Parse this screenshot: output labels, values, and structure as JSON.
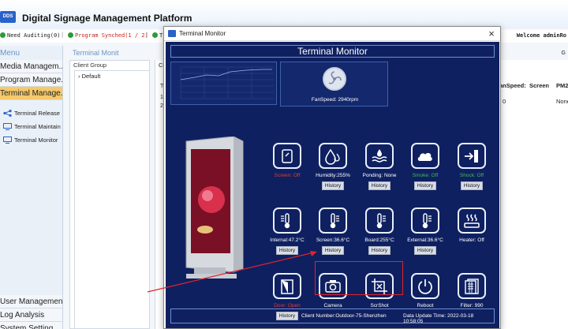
{
  "app": {
    "logo_text": "DDS",
    "title": "Digital Signage Management Platform",
    "status": [
      {
        "text": "Need Auditing(0)",
        "style": "normal"
      },
      {
        "text": "Program Synched(1 / 2)",
        "style": "red"
      },
      {
        "text": "T",
        "style": "normal"
      }
    ],
    "welcome": "Welcome adminRo"
  },
  "sidebar": {
    "menu_label": "Menu",
    "items": [
      {
        "label": "Media Managem..."
      },
      {
        "label": "Program Manage..."
      },
      {
        "label": "Terminal Manage..."
      }
    ],
    "sub_items": [
      {
        "label": "Terminal Release",
        "icon": "share-icon"
      },
      {
        "label": "Terminal Maintain",
        "icon": "monitor-icon"
      },
      {
        "label": "Terminal Monitor",
        "icon": "monitor-icon"
      }
    ],
    "bottom_items": [
      {
        "label": "User Management"
      },
      {
        "label": "Log Analysis"
      },
      {
        "label": "System Setting"
      }
    ]
  },
  "main": {
    "section_title": "Terminal Monit",
    "client_group_label": "Client Group",
    "tree_default": "Default",
    "right_tab": "Cl",
    "gtag": "G",
    "table": {
      "headers": [
        "anSpeed:",
        "Screen",
        "PM2"
      ],
      "row_numbers": [
        "1",
        "2"
      ],
      "row2": [
        "0",
        "None"
      ],
      "col_label": "T"
    }
  },
  "dialog": {
    "title": "Terminal Monitor",
    "close_glyph": "×",
    "monitor_title": "Terminal Monitor",
    "fan_label": "FanSpeed: 2940rpm",
    "history_label": "History",
    "tiles": [
      {
        "label": "Screen: Off",
        "style": "red",
        "icon": "screen-icon",
        "history": false
      },
      {
        "label": "Humidity:255%",
        "style": "normal",
        "icon": "humidity-icon",
        "history": true
      },
      {
        "label": "Ponding: None",
        "style": "normal",
        "icon": "ponding-icon",
        "history": true
      },
      {
        "label": "Smoke: Off",
        "style": "green",
        "icon": "smoke-icon",
        "history": true
      },
      {
        "label": "Shock: Off",
        "style": "green",
        "icon": "shock-icon",
        "history": true
      },
      {
        "label": "Internal:47.2°C",
        "style": "normal",
        "icon": "thermometer-icon",
        "history": true
      },
      {
        "label": "Screen:36.6°C",
        "style": "normal",
        "icon": "thermometer-icon",
        "history": true
      },
      {
        "label": "Board:255°C",
        "style": "normal",
        "icon": "thermometer-icon",
        "history": true
      },
      {
        "label": "External:36.6°C",
        "style": "normal",
        "icon": "thermometer-icon",
        "history": true
      },
      {
        "label": "Heater: Off",
        "style": "normal",
        "icon": "heater-icon",
        "history": false
      },
      {
        "label": "Door: Open",
        "style": "red",
        "icon": "door-icon",
        "history": true
      },
      {
        "label": "Camera",
        "style": "normal",
        "icon": "camera-icon",
        "history": false
      },
      {
        "label": "ScrShot",
        "style": "normal",
        "icon": "screenshot-icon",
        "history": false
      },
      {
        "label": "Reboot",
        "style": "normal",
        "icon": "reboot-icon",
        "history": false
      },
      {
        "label": "Filter: 990",
        "style": "normal",
        "icon": "filter-icon",
        "history": false
      }
    ],
    "footer": {
      "client": "Client Number:Outdoor-75-Shenzhen",
      "time": "Data Update Time: 2022-03-18 10:58:05"
    }
  },
  "colors": {
    "monitor_bg": "#0f2061",
    "accent_blue": "#2a62c9",
    "alert_red": "#e33b35",
    "ok_green": "#3fbf4a",
    "menu_active": "#f5c96b",
    "highlight": "#e0242a"
  }
}
